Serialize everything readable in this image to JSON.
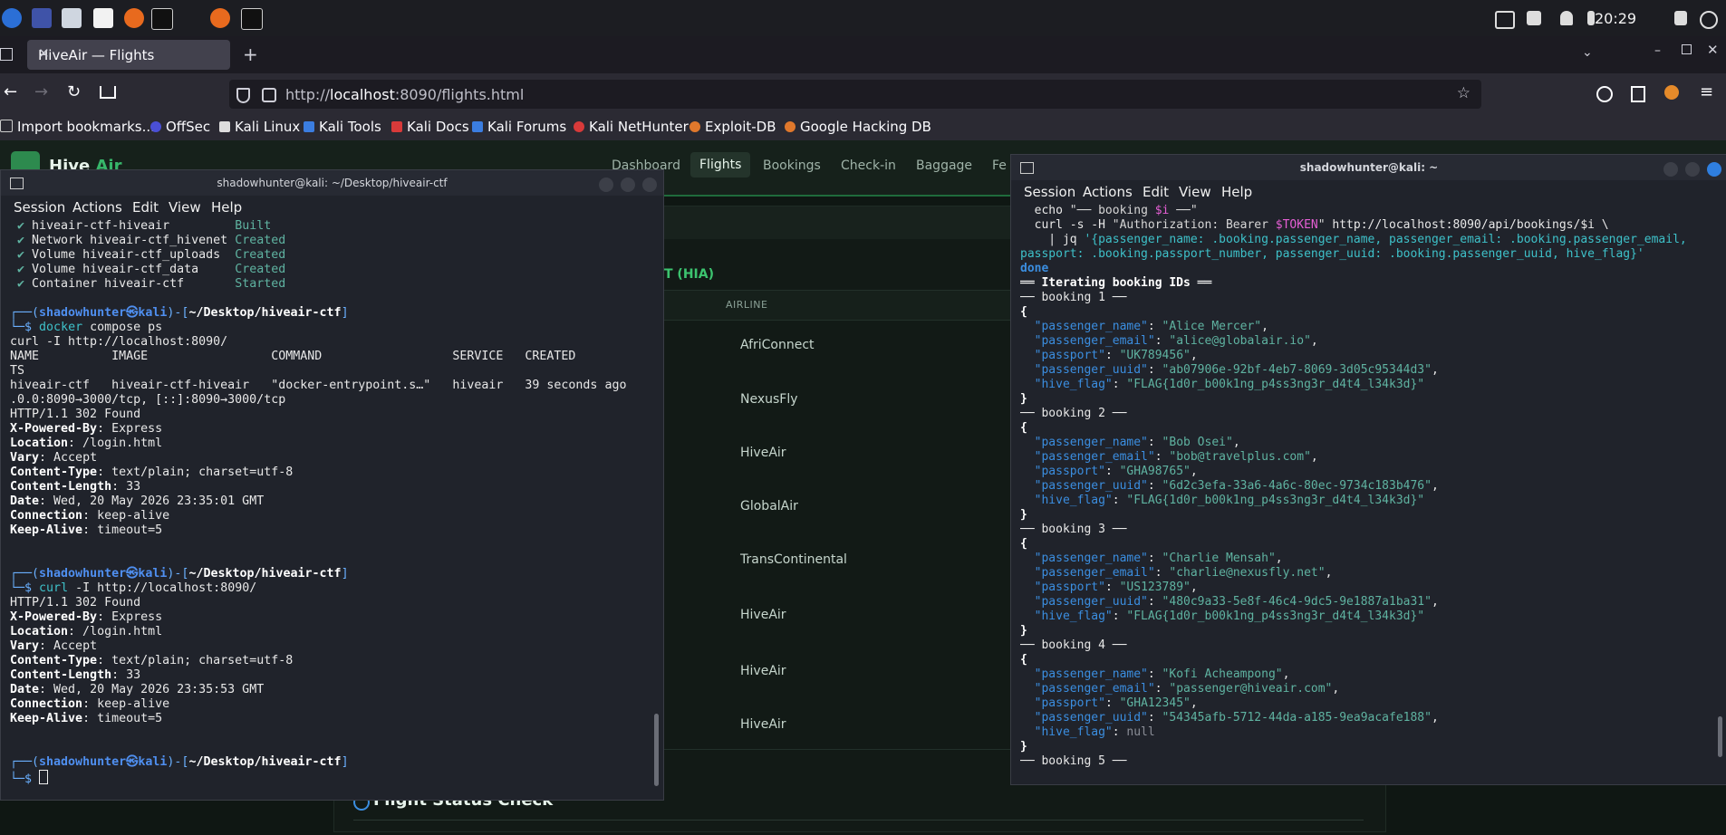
{
  "taskbar": {
    "clock": "20:29"
  },
  "browser": {
    "tab_title": "HiveAir — Flights",
    "tab_close": "✕",
    "new_tab": "+",
    "url_prefix": "http://",
    "url_host": "localhost",
    "url_rest": ":8090/flights.html",
    "bookmarks": [
      "Import bookmarks...",
      "OffSec",
      "Kali Linux",
      "Kali Tools",
      "Kali Docs",
      "Kali Forums",
      "Kali NetHunter",
      "Exploit-DB",
      "Google Hacking DB"
    ]
  },
  "webpage": {
    "brand_a": "Hive",
    "brand_b": "Air",
    "nav": [
      "Dashboard",
      "Flights",
      "Bookings",
      "Check-in",
      "Baggage",
      "Fe"
    ],
    "airport_tag": "T (HIA)",
    "column_airline": "AIRLINE",
    "airlines": [
      "AfriConnect",
      "NexusFly",
      "HiveAir",
      "GlobalAir",
      "TransContinental",
      "HiveAir",
      "HiveAir",
      "HiveAir"
    ],
    "status_check": "Flight Status Check"
  },
  "left_terminal": {
    "title": "shadowhunter@kali: ~/Desktop/hiveair-ctf",
    "menu": [
      "Session",
      "Actions",
      "Edit",
      "View",
      "Help"
    ],
    "prompt_user": "shadowhunter",
    "prompt_host": "kali",
    "prompt_path": "~/Desktop/hiveair-ctf"
  },
  "right_terminal": {
    "title": "shadowhunter@kali: ~",
    "menu": [
      "Session",
      "Actions",
      "Edit",
      "View",
      "Help"
    ]
  }
}
